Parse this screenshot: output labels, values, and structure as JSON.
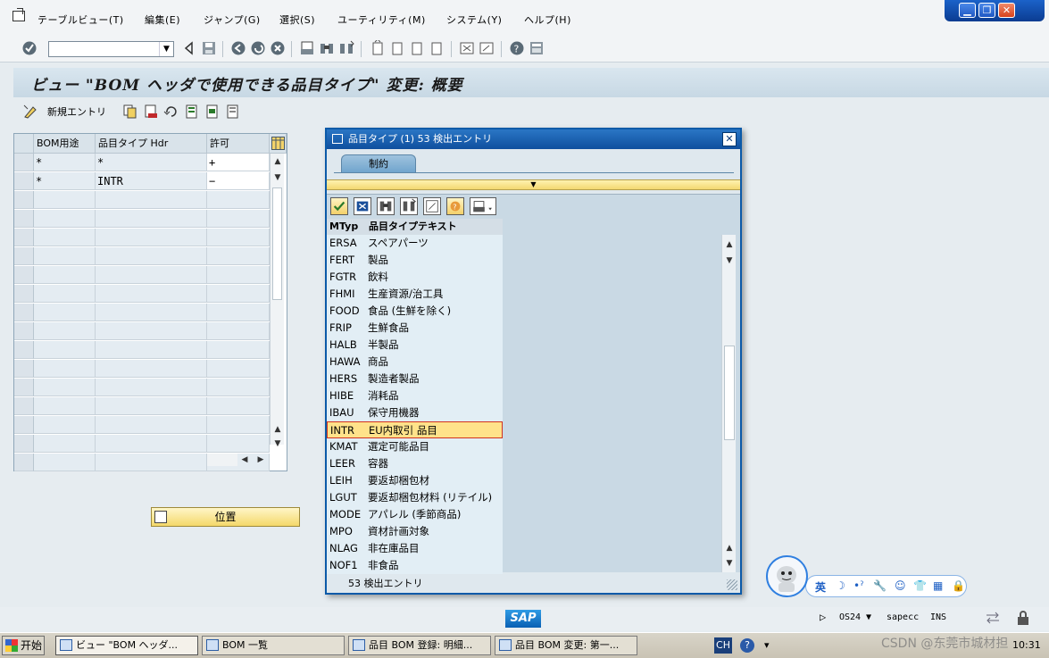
{
  "menu": {
    "items": [
      "テーブルビュー(T)",
      "編集(E)",
      "ジャンプ(G)",
      "選択(S)",
      "ユーティリティ(M)",
      "システム(Y)",
      "ヘルプ(H)"
    ]
  },
  "window_buttons": {
    "minimize": "▁",
    "restore": "❐",
    "close": "✕"
  },
  "title": "ビュー \"BOM ヘッダで使用できる品目タイプ\" 変更: 概要",
  "app_toolbar": {
    "new_entries": "新規エントリ"
  },
  "left_table": {
    "headers": [
      "BOM用途",
      "品目タイプ Hdr",
      "許可"
    ],
    "rows": [
      [
        "*",
        "*",
        "+"
      ],
      [
        "*",
        "INTR",
        "−"
      ]
    ]
  },
  "position_button": "位置",
  "popup": {
    "title": "品目タイプ (1)   53 検出エントリ",
    "close": "✕",
    "tab": "制約",
    "yellow_marker": "▼",
    "columns": [
      "MTyp",
      "品目タイプテキスト"
    ],
    "rows": [
      [
        "ERSA",
        "スペアパーツ"
      ],
      [
        "FERT",
        "製品"
      ],
      [
        "FGTR",
        "飲料"
      ],
      [
        "FHMI",
        "生産資源/治工具"
      ],
      [
        "FOOD",
        "食品 (生鮮を除く)"
      ],
      [
        "FRIP",
        "生鮮食品"
      ],
      [
        "HALB",
        "半製品"
      ],
      [
        "HAWA",
        "商品"
      ],
      [
        "HERS",
        "製造者製品"
      ],
      [
        "HIBE",
        "消耗品"
      ],
      [
        "IBAU",
        "保守用機器"
      ],
      [
        "INTR",
        "EU内取引 品目"
      ],
      [
        "KMAT",
        "選定可能品目"
      ],
      [
        "LEER",
        "容器"
      ],
      [
        "LEIH",
        "要返却梱包材"
      ],
      [
        "LGUT",
        "要返却梱包材料 (リテイル)"
      ],
      [
        "MODE",
        "アパレル (季節商品)"
      ],
      [
        "MPO",
        "資材計画対象"
      ],
      [
        "NLAG",
        "非在庫品目"
      ],
      [
        "NOF1",
        "非食品"
      ]
    ],
    "selected_index": 11,
    "status": "53 検出エントリ"
  },
  "ime": {
    "lang": "英",
    "moon": "☽",
    "punct": "•ˀ",
    "wrench": "🔧",
    "smile": "☺",
    "shirt": "👕",
    "grid": "▦",
    "lock": "🔒"
  },
  "status_bar": {
    "logo": "SAP",
    "play": "▷",
    "system": "OS24",
    "dropdown": "▼",
    "client": "sapecc",
    "mode": "INS"
  },
  "taskbar": {
    "start": "开始",
    "tasks": [
      "ビュー \"BOM ヘッダ...",
      "BOM 一覧",
      "品目 BOM 登録: 明細...",
      "品目 BOM 変更: 第一..."
    ],
    "lang": "CH",
    "help": "?",
    "clock": "10:31"
  },
  "watermark": "CSDN @东莞市城材担",
  "colors": {
    "accent": "#0f4f9e",
    "selected_row": "#ffe28a",
    "selected_border": "#d1321f",
    "button_yellow": "#f4d86a"
  }
}
